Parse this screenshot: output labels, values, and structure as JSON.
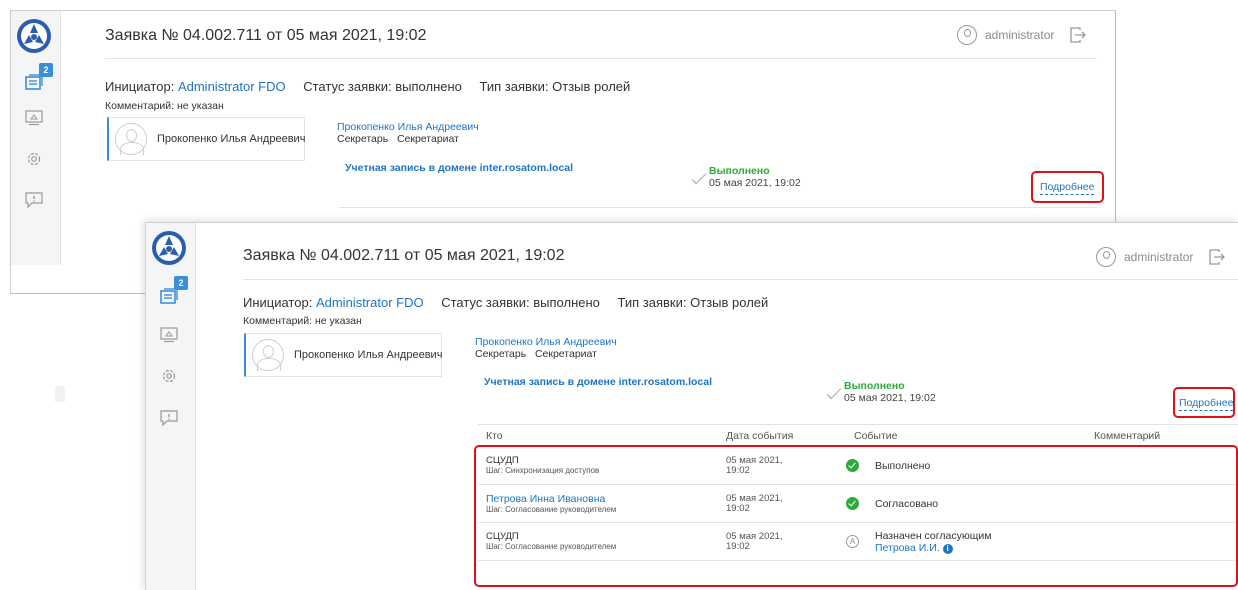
{
  "brand": {
    "logo_icon": "rosatom-logo-icon",
    "accent": "#1f74c3",
    "success": "#2eaa3a",
    "highlight": "#e0101a"
  },
  "sidebar": {
    "requests_badge": "2",
    "items": [
      {
        "icon": "requests-icon"
      },
      {
        "icon": "monitor-icon"
      },
      {
        "icon": "gear-icon"
      },
      {
        "icon": "feedback-icon"
      }
    ]
  },
  "header": {
    "title": "Заявка № 04.002.711 от 05 мая 2021, 19:02",
    "user": "administrator"
  },
  "request": {
    "initiator_label": "Инициатор:",
    "initiator_name": "Administrator FDO",
    "status_label": "Статус заявки:",
    "status_value": "выполнено",
    "type_label": "Тип заявки:",
    "type_value": "Отзыв ролей",
    "comment": "Комментарий: не указан"
  },
  "subject": {
    "name": "Прокопенко Илья Андреевич"
  },
  "role": {
    "name": "Прокопенко Илья Андреевич",
    "position": "Секретарь",
    "group": "Секретариат"
  },
  "account": {
    "link": "Учетная запись в домене inter.rosatom.local",
    "status": "Выполнено",
    "date": "05 мая 2021, 19:02",
    "more": "Подробнее"
  },
  "history": {
    "columns": [
      "Кто",
      "Дата события",
      "Событие",
      "Комментарий"
    ],
    "rows": [
      {
        "who": "СЦУДП",
        "step": "Шаг: Синхронизация доступов",
        "date1": "05 мая 2021,",
        "date2": "19:02",
        "icon": "success-check-icon",
        "event": "Выполнено",
        "event_sub": ""
      },
      {
        "who": "Петрова Инна Ивановна",
        "step": "Шаг: Согласование руководителем",
        "date1": "05 мая 2021,",
        "date2": "19:02",
        "icon": "success-check-icon",
        "event": "Согласовано",
        "event_sub": ""
      },
      {
        "who": "СЦУДП",
        "step": "Шаг: Согласование руководителем",
        "date1": "05 мая 2021,",
        "date2": "19:02",
        "icon": "assigned-icon",
        "event": "Назначен согласующим",
        "event_sub": "Петрова И.И."
      }
    ]
  }
}
